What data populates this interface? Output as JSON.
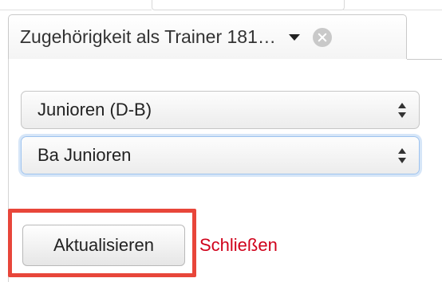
{
  "filter": {
    "title": "Zugehörigkeit als Trainer 181…"
  },
  "selects": {
    "category_value": "Junioren (D-B)",
    "team_value": "Ba Junioren"
  },
  "actions": {
    "update_label": "Aktualisieren",
    "close_label": "Schließen"
  },
  "colors": {
    "highlight": "#e8463a",
    "close_link": "#d0021b",
    "focus_ring": "#9ec3ef"
  },
  "icons": {
    "dropdown": "caret-down-icon",
    "remove": "close-circle-icon",
    "select_arrows": "up-down-arrows-icon"
  }
}
